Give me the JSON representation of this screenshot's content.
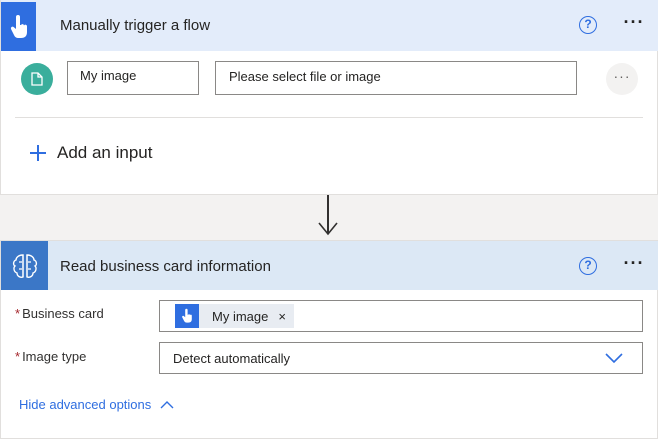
{
  "trigger": {
    "title": "Manually trigger a flow",
    "help_glyph": "?",
    "more_glyph": "···",
    "input_name": "My image",
    "input_placeholder": "Please select file or image",
    "row_more_glyph": "···",
    "add_input_label": "Add an input"
  },
  "action": {
    "title": "Read business card information",
    "help_glyph": "?",
    "more_glyph": "···",
    "fields": [
      {
        "label": "Business card",
        "required": true,
        "token": "My image",
        "token_remove": "×"
      },
      {
        "label": "Image type",
        "required": true,
        "value": "Detect automatically"
      }
    ],
    "advanced_label": "Hide advanced options"
  },
  "icons": {
    "trigger": "hand-pointer-icon",
    "file": "file-icon",
    "add": "plus-icon",
    "connector": "arrow-down-icon",
    "action": "ai-brain-icon",
    "dropdown": "chevron-down-icon",
    "collapse": "chevron-up-icon"
  },
  "colors": {
    "accent": "#2f6ee0",
    "trigger_header": "#e3ecfa",
    "action_header": "#dce8f5",
    "action_icon_bg": "#3b77c7",
    "file_badge": "#3aae9c",
    "required": "#a4262c"
  }
}
